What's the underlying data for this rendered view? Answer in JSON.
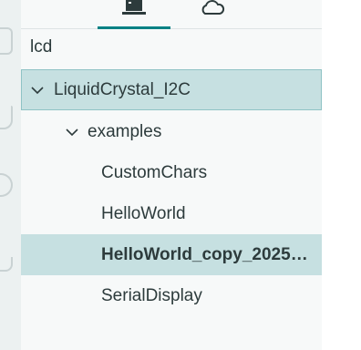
{
  "tabs": [
    {
      "name": "local",
      "icon": "laptop-icon",
      "active": true
    },
    {
      "name": "cloud",
      "icon": "cloud-icon",
      "active": false
    }
  ],
  "filter": {
    "text": "lcd"
  },
  "tree": {
    "library": {
      "label": "LiquidCrystal_I2C",
      "expanded": true
    },
    "folder": {
      "label": "examples",
      "expanded": true
    },
    "items": [
      {
        "label": "CustomChars",
        "selected": false
      },
      {
        "label": "HelloWorld",
        "selected": false
      },
      {
        "label": "HelloWorld_copy_20251...",
        "selected": true
      },
      {
        "label": "SerialDisplay",
        "selected": false
      }
    ]
  },
  "colors": {
    "accent": "#008184",
    "selection": "#c6e0e1",
    "panel_bg": "#f7f9f9",
    "rail_bg": "#ecf1f1"
  }
}
